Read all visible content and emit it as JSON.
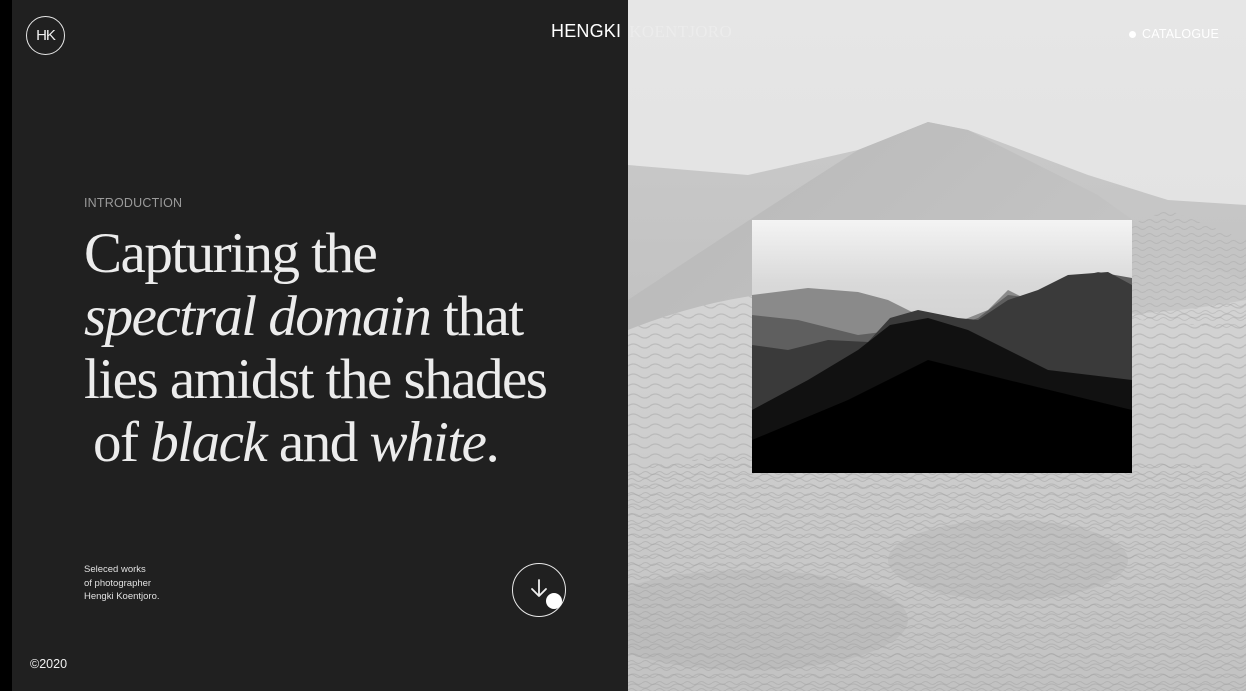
{
  "header": {
    "logo_text": "HK",
    "brand_first": "HENGKI",
    "brand_last": "KOENTJORO",
    "catalogue_label": "CATALOGUE",
    "catalogue_icon": "bullet-dot-icon"
  },
  "intro": {
    "label": "INTRODUCTION",
    "headline": {
      "l1": "Capturing the",
      "l2_italic": "spectral domain",
      "l2_rest": " that",
      "l3": "lies amidst the shades",
      "l4_pre": "of ",
      "l4_italic1": "black",
      "l4_mid": " and ",
      "l4_italic2": "white",
      "l4_end": "."
    },
    "description": {
      "l1": "Seleced works",
      "l2": "of photographer",
      "l3": "Hengki Koentjoro."
    },
    "scroll_icon": "arrow-down-icon"
  },
  "footer": {
    "copyright": "©2020"
  },
  "colors": {
    "left_panel": "#202020",
    "background": "#000000",
    "text_primary": "#ececec",
    "text_muted": "#9a9a9a"
  },
  "images": {
    "background": "desert-dune-photo",
    "inset": "mountain-silhouette-photo"
  }
}
